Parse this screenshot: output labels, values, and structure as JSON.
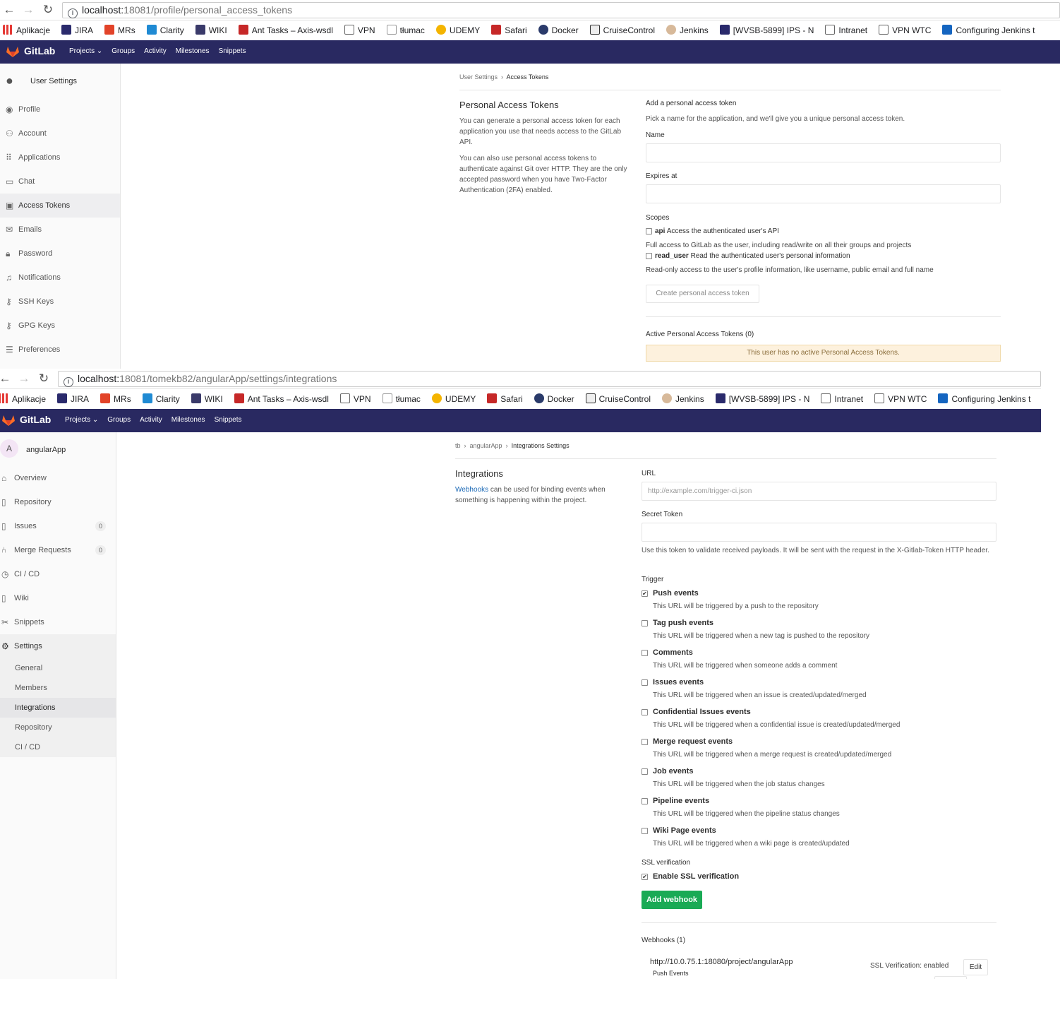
{
  "browser": {
    "bookmarks": [
      "Aplikacje",
      "JIRA",
      "MRs",
      "Clarity",
      "WIKI",
      "Ant Tasks – Axis-wsdl",
      "VPN",
      "tłumac",
      "UDEMY",
      "Safari",
      "Docker",
      "CruiseControl",
      "Jenkins",
      "[WVSB-5899] IPS - N",
      "Intranet",
      "VPN WTC",
      "Configuring Jenkins t"
    ]
  },
  "top": {
    "url_host": "localhost:",
    "url_path": "18081/profile/personal_access_tokens",
    "brand": "GitLab",
    "nav": [
      "Projects ⌄",
      "Groups",
      "Activity",
      "Milestones",
      "Snippets"
    ],
    "sidebar_title": "User Settings",
    "sidebar": [
      "Profile",
      "Account",
      "Applications",
      "Chat",
      "Access Tokens",
      "Emails",
      "Password",
      "Notifications",
      "SSH Keys",
      "GPG Keys",
      "Preferences"
    ],
    "breadcrumb": [
      "User Settings",
      "Access Tokens"
    ],
    "section_title": "Personal Access Tokens",
    "section_p1": "You can generate a personal access token for each application you use that needs access to the GitLab API.",
    "section_p2": "You can also use personal access tokens to authenticate against Git over HTTP. They are the only accepted password when you have Two-Factor Authentication (2FA) enabled.",
    "add_title": "Add a personal access token",
    "add_desc": "Pick a name for the application, and we'll give you a unique personal access token.",
    "name_label": "Name",
    "expires_label": "Expires at",
    "scopes_label": "Scopes",
    "scope_api_name": "api",
    "scope_api_desc": "Access the authenticated user's API",
    "scope_api_help": "Full access to GitLab as the user, including read/write on all their groups and projects",
    "scope_read_name": "read_user",
    "scope_read_desc": "Read the authenticated user's personal information",
    "scope_read_help": "Read-only access to the user's profile information, like username, public email and full name",
    "create_button": "Create personal access token",
    "active_title": "Active Personal Access Tokens (0)",
    "no_tokens": "This user has no active Personal Access Tokens."
  },
  "bottom": {
    "url_host": "localhost:",
    "url_path": "18081/tomekb82/angularApp/settings/integrations",
    "brand": "GitLab",
    "nav": [
      "Projects ⌄",
      "Groups",
      "Activity",
      "Milestones",
      "Snippets"
    ],
    "project_avatar": "A",
    "project_name": "angularApp",
    "sidebar": [
      {
        "label": "Overview",
        "icon": "⌂"
      },
      {
        "label": "Repository",
        "icon": "▯"
      },
      {
        "label": "Issues",
        "icon": "▯",
        "badge": "0"
      },
      {
        "label": "Merge Requests",
        "icon": "⑃",
        "badge": "0"
      },
      {
        "label": "CI / CD",
        "icon": "◷"
      },
      {
        "label": "Wiki",
        "icon": "▯"
      },
      {
        "label": "Snippets",
        "icon": "✂"
      },
      {
        "label": "Settings",
        "icon": "⚙"
      }
    ],
    "settings_sub": [
      "General",
      "Members",
      "Integrations",
      "Repository",
      "CI / CD"
    ],
    "breadcrumb": [
      "tb",
      "angularApp",
      "Integrations Settings"
    ],
    "section_title": "Integrations",
    "section_link": "Webhooks",
    "section_text": " can be used for binding events when something is happening within the project.",
    "url_label": "URL",
    "url_placeholder": "http://example.com/trigger-ci.json",
    "secret_label": "Secret Token",
    "secret_help": "Use this token to validate received payloads. It will be sent with the request in the X-Gitlab-Token HTTP header.",
    "trigger_label": "Trigger",
    "triggers": [
      {
        "name": "Push events",
        "desc": "This URL will be triggered by a push to the repository",
        "checked": true
      },
      {
        "name": "Tag push events",
        "desc": "This URL will be triggered when a new tag is pushed to the repository",
        "checked": false
      },
      {
        "name": "Comments",
        "desc": "This URL will be triggered when someone adds a comment",
        "checked": false
      },
      {
        "name": "Issues events",
        "desc": "This URL will be triggered when an issue is created/updated/merged",
        "checked": false
      },
      {
        "name": "Confidential Issues events",
        "desc": "This URL will be triggered when a confidential issue is created/updated/merged",
        "checked": false
      },
      {
        "name": "Merge request events",
        "desc": "This URL will be triggered when a merge request is created/updated/merged",
        "checked": false
      },
      {
        "name": "Job events",
        "desc": "This URL will be triggered when the job status changes",
        "checked": false
      },
      {
        "name": "Pipeline events",
        "desc": "This URL will be triggered when the pipeline status changes",
        "checked": false
      },
      {
        "name": "Wiki Page events",
        "desc": "This URL will be triggered when a wiki page is created/updated",
        "checked": false
      }
    ],
    "ssl_label": "SSL verification",
    "ssl_option": "Enable SSL verification",
    "add_button": "Add webhook",
    "webhooks_title": "Webhooks (1)",
    "webhook_url": "http://10.0.75.1:18080/project/angularApp",
    "webhook_events": "Push Events",
    "webhook_ssl": "SSL Verification: enabled",
    "edit_button": "Edit"
  }
}
